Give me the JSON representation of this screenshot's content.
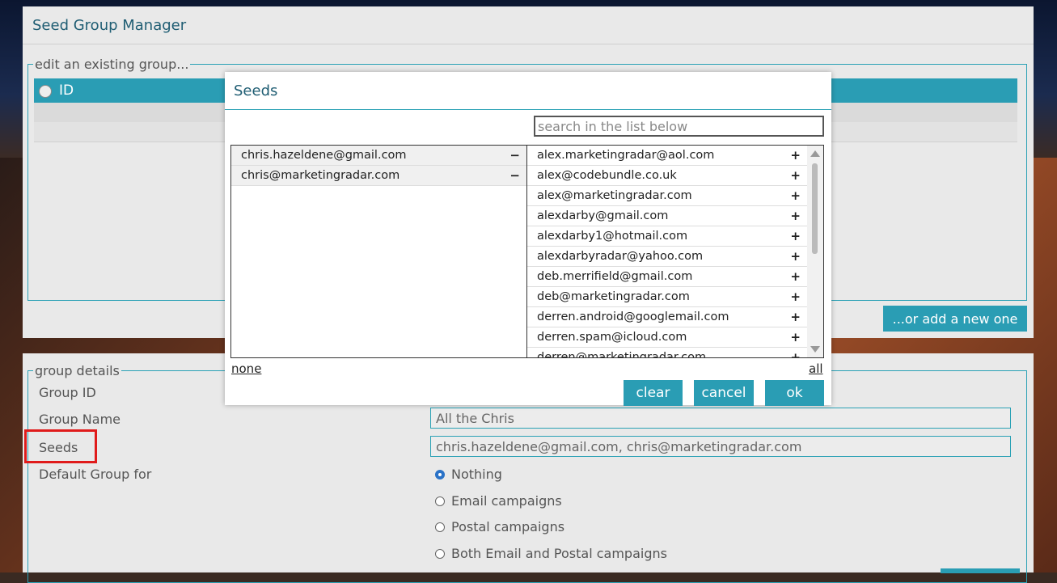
{
  "app": {
    "title": "Seed Group Manager"
  },
  "edit_group": {
    "legend": "edit an existing group...",
    "grid_column_id": "ID",
    "add_new_label": "...or add a new one"
  },
  "details": {
    "legend": "group details",
    "group_id_label": "Group ID",
    "group_name_label": "Group Name",
    "group_name_value": "All the Chris",
    "seeds_label": "Seeds",
    "seeds_value": "chris.hazeldene@gmail.com, chris@marketingradar.com",
    "default_group_label": "Default Group for",
    "default_options": [
      "Nothing",
      "Email campaigns",
      "Postal campaigns",
      "Both Email and Postal campaigns"
    ],
    "default_selected": "Nothing"
  },
  "modal": {
    "title": "Seeds",
    "search_placeholder": "search in the list below",
    "selected": [
      "chris.hazeldene@gmail.com",
      "chris@marketingradar.com"
    ],
    "available": [
      "alex.marketingradar@aol.com",
      "alex@codebundle.co.uk",
      "alex@marketingradar.com",
      "alexdarby@gmail.com",
      "alexdarby1@hotmail.com",
      "alexdarbyradar@yahoo.com",
      "deb.merrifield@gmail.com",
      "deb@marketingradar.com",
      "derren.android@googlemail.com",
      "derren.spam@icloud.com",
      "derren@marketingradar.com"
    ],
    "remove_symbol": "−",
    "add_symbol": "+",
    "none_link": "none",
    "all_link": "all",
    "clear_label": "clear",
    "cancel_label": "cancel",
    "ok_label": "ok"
  }
}
